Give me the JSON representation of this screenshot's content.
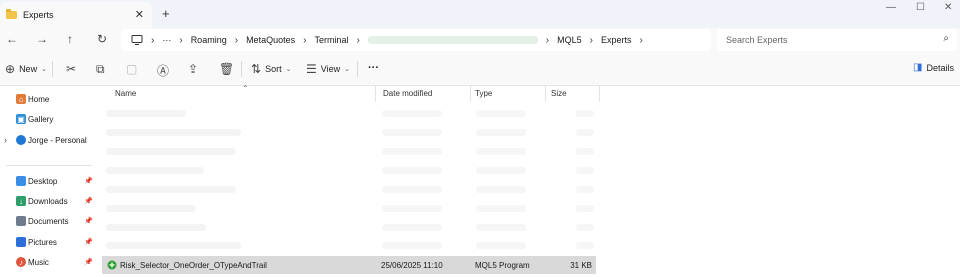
{
  "tab": {
    "title": "Experts",
    "close": "✕",
    "new": "+"
  },
  "window": {
    "minimize": "—",
    "maximize": "☐",
    "close": "✕"
  },
  "nav": {
    "back": "←",
    "forward": "→",
    "up": "↑",
    "refresh": "↻"
  },
  "breadcrumb": {
    "pc_icon": "pc-icon",
    "more": "···",
    "items": [
      "Roaming",
      "MetaQuotes",
      "Terminal",
      "MQL5",
      "Experts"
    ]
  },
  "search": {
    "placeholder": "Search Experts",
    "icon": "⌕"
  },
  "toolbar": {
    "new_label": "New",
    "sort_label": "Sort",
    "view_label": "View",
    "more_label": "···",
    "details_label": "Details"
  },
  "sidebar": {
    "items": [
      {
        "label": "Home",
        "icon": "home-icon",
        "color": "#e07b39"
      },
      {
        "label": "Gallery",
        "icon": "gallery-icon",
        "color": "#2f8fd8"
      },
      {
        "label": "Jorge - Personal",
        "icon": "onedrive-icon",
        "color": "#1e78d4"
      },
      {
        "label": "Desktop",
        "icon": "desktop-icon",
        "color": "#3a8ee6"
      },
      {
        "label": "Downloads",
        "icon": "downloads-icon",
        "color": "#2e9e6a"
      },
      {
        "label": "Documents",
        "icon": "documents-icon",
        "color": "#6d7d8f"
      },
      {
        "label": "Pictures",
        "icon": "pictures-icon",
        "color": "#2f6fd8"
      },
      {
        "label": "Music",
        "icon": "music-icon",
        "color": "#e0533c"
      }
    ],
    "pin": "📌",
    "expand": "›"
  },
  "columns": {
    "name": "Name",
    "date": "Date modified",
    "type": "Type",
    "size": "Size"
  },
  "file": {
    "name": "Risk_Selector_OneOrder_OTypeAndTrail",
    "date": "25/06/2025 11:10",
    "type": "MQL5 Program",
    "size": "31 KB",
    "icon": "mql5-program-icon",
    "icon_color": "#2e9e3a"
  }
}
